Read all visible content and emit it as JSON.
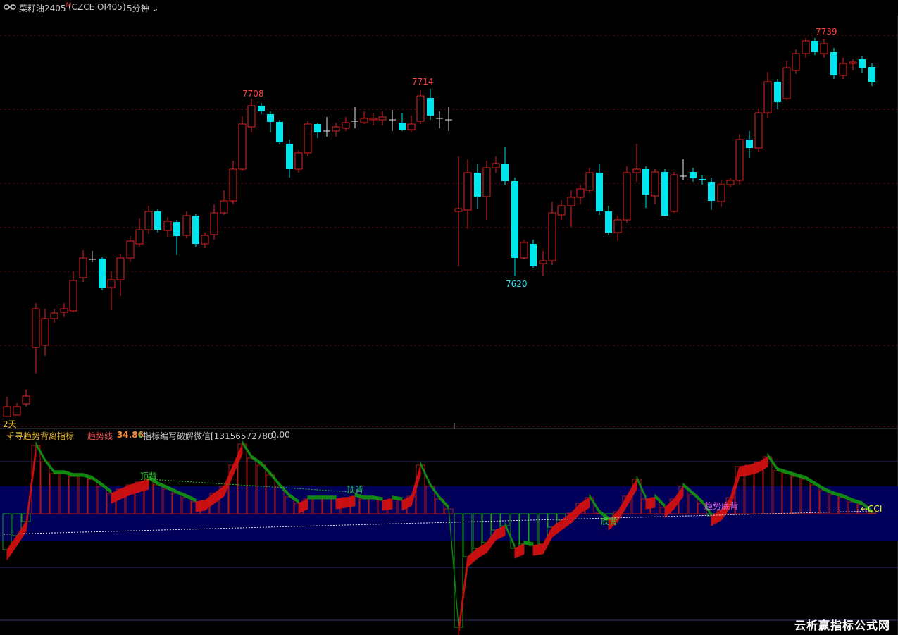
{
  "window": {
    "symbol_name": "菜籽油2405",
    "symbol_flag": "M",
    "symbol_code": "(CZCE OI405)",
    "period_label": "5分钟"
  },
  "main_chart": {
    "day_label": "2天",
    "high_label_1": "7708",
    "high_label_2": "7714",
    "low_label": "7620",
    "high_label_3": "7739"
  },
  "indicator_bar": {
    "indicator_name": "千寻趋势背离指标",
    "series_name": "趋势线",
    "series_value": "34.86",
    "series_arrow": "↓",
    "note": "指标编写破解微信[13156572780]",
    "extra_value": "0.00"
  },
  "indicator_panel": {
    "annotation_top_div_1": "顶背",
    "annotation_top_div_2": "顶背",
    "annotation_bottom_div": "底背",
    "annotation_trend_bottom_div": "趋势底背",
    "cci_label": "←CCI"
  },
  "watermark": "云析赢指标公式网",
  "colors": {
    "up": "#e02020",
    "down": "#00e5ee",
    "indicator_red": "#d01010",
    "indicator_green": "#109010",
    "band": "#00005a"
  }
}
